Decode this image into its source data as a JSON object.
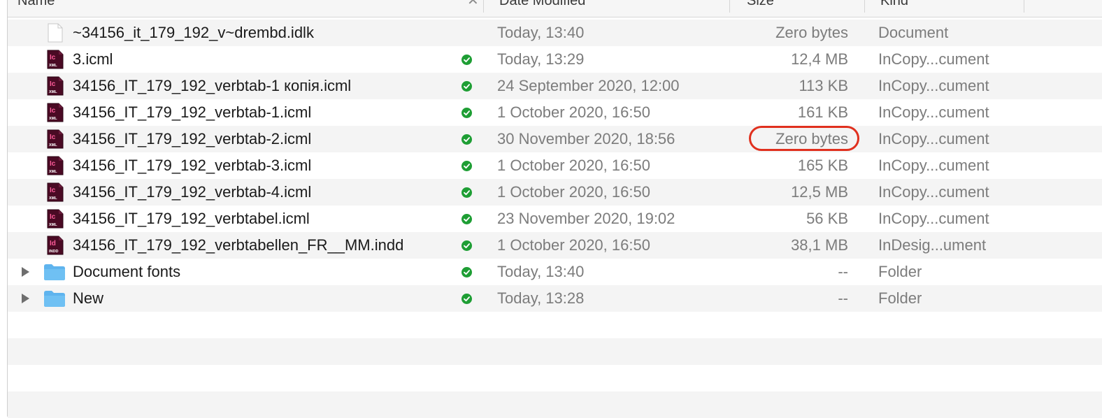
{
  "header": {
    "name": "Name",
    "date_modified": "Date Modified",
    "size": "Size",
    "kind": "Kind"
  },
  "rows": [
    {
      "name": "~34156_it_179_192_v~drembd.idlk",
      "date": "Today, 13:40",
      "size": "Zero bytes",
      "kind": "Document",
      "icon": "generic-document-icon",
      "synced": false,
      "folder": false
    },
    {
      "name": "3.icml",
      "date": "Today, 13:29",
      "size": "12,4 MB",
      "kind": "InCopy...cument",
      "icon": "incopy-file-icon",
      "synced": true,
      "folder": false
    },
    {
      "name": "34156_IT_179_192_verbtab-1 копія.icml",
      "date": "24 September 2020, 12:00",
      "size": "113 KB",
      "kind": "InCopy...cument",
      "icon": "incopy-file-icon",
      "synced": true,
      "folder": false
    },
    {
      "name": "34156_IT_179_192_verbtab-1.icml",
      "date": "1 October 2020, 16:50",
      "size": "161 KB",
      "kind": "InCopy...cument",
      "icon": "incopy-file-icon",
      "synced": true,
      "folder": false
    },
    {
      "name": "34156_IT_179_192_verbtab-2.icml",
      "date": "30 November 2020, 18:56",
      "size": "Zero bytes",
      "kind": "InCopy...cument",
      "icon": "incopy-file-icon",
      "synced": true,
      "folder": false,
      "highlight": true
    },
    {
      "name": "34156_IT_179_192_verbtab-3.icml",
      "date": "1 October 2020, 16:50",
      "size": "165 KB",
      "kind": "InCopy...cument",
      "icon": "incopy-file-icon",
      "synced": true,
      "folder": false
    },
    {
      "name": "34156_IT_179_192_verbtab-4.icml",
      "date": "1 October 2020, 16:50",
      "size": "12,5 MB",
      "kind": "InCopy...cument",
      "icon": "incopy-file-icon",
      "synced": true,
      "folder": false
    },
    {
      "name": "34156_IT_179_192_verbtabel.icml",
      "date": "23 November 2020, 19:02",
      "size": "56 KB",
      "kind": "InCopy...cument",
      "icon": "incopy-file-icon",
      "synced": true,
      "folder": false
    },
    {
      "name": "34156_IT_179_192_verbtabellen_FR__MM.indd",
      "date": "1 October 2020, 16:50",
      "size": "38,1 MB",
      "kind": "InDesig...ument",
      "icon": "indesign-file-icon",
      "synced": true,
      "folder": false
    },
    {
      "name": "Document fonts",
      "date": "Today, 13:40",
      "size": "--",
      "kind": "Folder",
      "icon": "folder-icon",
      "synced": true,
      "folder": true
    },
    {
      "name": "New",
      "date": "Today, 13:28",
      "size": "--",
      "kind": "Folder",
      "icon": "folder-icon",
      "synced": true,
      "folder": true
    }
  ],
  "colors": {
    "highlight": "#e0301e",
    "synced": "#1e9e34",
    "incopy_bg": "#4a0a24",
    "incopy_text": "#ff5c9a",
    "folder": "#6fc0f3"
  }
}
